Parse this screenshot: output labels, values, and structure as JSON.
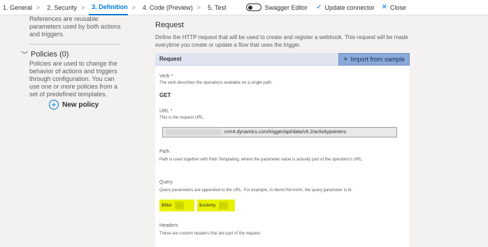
{
  "nav": {
    "steps": [
      {
        "label": "1. General"
      },
      {
        "label": "2. Security"
      },
      {
        "label": "3. Definition"
      },
      {
        "label": "4. Code (Preview)"
      },
      {
        "label": "5. Test"
      }
    ],
    "chevron": ">",
    "swagger_label": "Swagger Editor",
    "update_label": "Update connector",
    "close_label": "Close"
  },
  "left": {
    "references_text": "References are reusable parameters used by both actions and triggers.",
    "policies_title": "Policies (0)",
    "policies_desc": "Policies are used to change the behavior of actions and triggers through configuration. You can use one or more policies from a set of predefined templates.",
    "new_policy_label": "New policy"
  },
  "main": {
    "title": "Request",
    "description": "Define the HTTP request that will be used to create and register a webhook. This request will be made everytime you create or update a flow that uses the trigger.",
    "card": {
      "header": "Request",
      "import_label": "Import from sample",
      "verb_label": "Verb *",
      "verb_help": "The verb describes the operations available on a single path.",
      "verb_value": "GET",
      "url_label": "URL *",
      "url_help": "This is the request URL.",
      "url_value": ".crm4.dynamics.com/trigger/api/data/v9.2/activitypointers",
      "path_label": "Path",
      "path_help": "Path is used together with Path Templating, where the parameter value is actually part of the operation's URL.",
      "query_label": "Query",
      "query_help": "Query parameters are appended to the URL. For example, in /items?id=####, the query parameter is id.",
      "query_params": [
        "$filter",
        "$orderby"
      ],
      "query_remove": "...",
      "headers_label": "Headers",
      "headers_help": "These are custom headers that are part of the request."
    }
  },
  "colors": {
    "accent": "#0078d4",
    "highlight": "#e8f200",
    "import_button": "#8aa9d8"
  }
}
